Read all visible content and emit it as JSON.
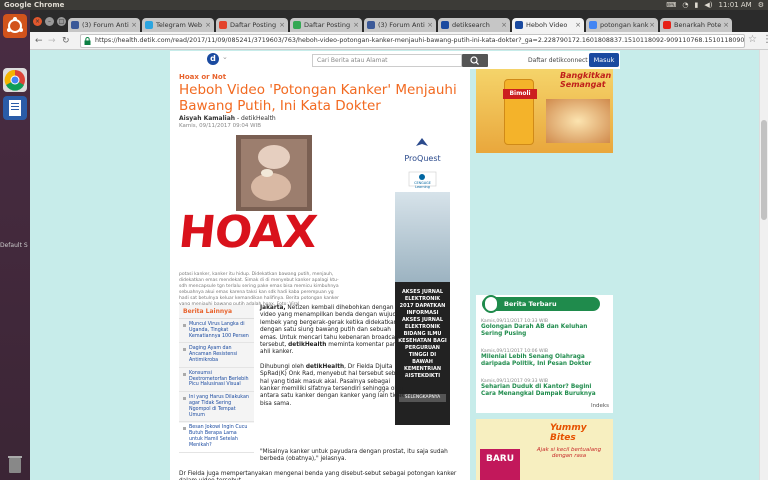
{
  "os": {
    "app_title": "Google Chrome",
    "clock": "11:01 AM",
    "sidebar_label": "Default S"
  },
  "browser": {
    "tabs": [
      {
        "label": "(3) Forum Anti",
        "favicon_color": "#3b5998"
      },
      {
        "label": "Telegram Web",
        "favicon_color": "#2ca5e0"
      },
      {
        "label": "Daftar Posting",
        "favicon_color": "#e3432c"
      },
      {
        "label": "Daftar Posting",
        "favicon_color": "#34a853"
      },
      {
        "label": "(3) Forum Anti",
        "favicon_color": "#3b5998"
      },
      {
        "label": "detiksearch",
        "favicon_color": "#1a4aa0"
      },
      {
        "label": "Heboh Video",
        "favicon_color": "#1a4aa0"
      },
      {
        "label": "potongan kank",
        "favicon_color": "#4285f4"
      },
      {
        "label": "Benarkah Pote",
        "favicon_color": "#e62117"
      }
    ],
    "url": "https://health.detik.com/read/2017/11/09/085241/3719603/763/heboh-video-potongan-kanker-menjauhi-bawang-putih-ini-kata-dokter?_ga=2.228790172.1601808837.1510118092-909110768.1510118090"
  },
  "site": {
    "search_placeholder": "Cari Berita atau Alamat",
    "connect_label": "Daftar detikconnect",
    "login_label": "Masuk"
  },
  "article": {
    "kicker": "Hoax or Not",
    "title": "Heboh Video 'Potongan Kanker' Menjauhi Bawang Putih, Ini Kata Dokter",
    "author": "Aisyah Kamaliah",
    "source": "- detikHealth",
    "date": "Kamis, 09/11/2017 09:04 WIB",
    "stamp": "HOAX",
    "caption": "potasi kanker, kanker itu hidup. Didekatkan bawang putih, menjauh, didekatkan emas mendekat. Simak di di menyebut kanker apalagi ktu-sdh mencapsule tgn terlalu sering pake emas bisa memicu kimbuhnya sebuahnya akui emas karena taksi kan sdk hadi kaba perempuan yg hadi sat betulnya keluar kemandikan halifinya. Berita potongan kanker yang menjauhi bawang putih adalah hoax. Foto: Viral",
    "related_title": "Berita Lainnya",
    "related": [
      "Muncul Virus Langka di Uganda, Tingkat Kematiannya 100 Persen",
      "Daging Ayam dan Ancaman Resistensi Antimikroba",
      "Konsumsi Dextrometorfan Berlebih Picu Halusinasi Visual",
      "Ini yang Harus Dilakukan agar Tidak Sering Ngompol di Tempat Umum",
      "Besan Jokowi Ingin Cucu Butuh Berapa Lama untuk Hamil Setelah Menikah?"
    ],
    "lead_bold": "Jakarta,",
    "lead": " Netizen kembali dihebohkan dengan video yang menampilkan benda dengan wujud lembek yang bergerak-gerak ketika didekatkan dengan satu siung bawang putih dan sebuah emas. Untuk mencari tahu kebenaran broadcast tersebut, ",
    "lead_bold2": "detikHealth",
    "lead_end": " meminta komentar para ahli kanker.",
    "p2_a": "Dihubungi oleh ",
    "p2_bold": "detikHealth",
    "p2_b": ", Dr Fielda Djuita SpRad(K) Onk Rad, menyebut hal tersebut sebagai hal yang tidak masuk akal. Pasalnya sebagai kanker memiliki sifatnya tersendiri sehingga obat antara satu kanker dengan kanker yang lain tidak bisa sama.",
    "p3": "\"Misalnya kanker untuk payudara dengan prostat, itu saja sudah berbeda (obatnya),\" jelasnya.",
    "p4": "Dr Fielda juga mempertanyakan mengenai benda yang disebut-sebut sebagai potongan kanker dalam video tersebut."
  },
  "ad_banner": {
    "brand": "ProQuest",
    "partner": "CENGAGE Learning",
    "text": "AKSES JURNAL ELEKTRONIK 2017 DAPATKAN INFORMASI AKSES JURNAL ELEKTRONIK BIDANG ILMU KESEHATAN BAGI PERGURUAN TINGGI DI BAWAH KEMENTRIAN RISTEKDIKTI",
    "cta": "SELENGKAPNYA"
  },
  "ad_bimoli": {
    "tagline": "Bangkitkan Semangat",
    "brand": "Bimoli"
  },
  "latest": {
    "title": "Berita Terbaru",
    "items": [
      {
        "date": "Kamis,09/11/2017 10:33 WIB",
        "title": "Golongan Darah AB dan Keluhan Sering Pusing"
      },
      {
        "date": "Kamis,09/11/2017 10:06 WIB",
        "title": "Milenial Lebih Senang Olahraga daripada Politik, Ini Pesan Dokter"
      },
      {
        "date": "Kamis,09/11/2017 09:33 WIB",
        "title": "Seharian Duduk di Kantor? Begini Cara Menangkal Dampak Buruknya"
      }
    ],
    "index_label": "Indeks"
  },
  "ad_yummy": {
    "badge": "BARU",
    "brand": "Yummy Bites",
    "slogan": "Ajak si kecil bertualang dengan rasa"
  }
}
